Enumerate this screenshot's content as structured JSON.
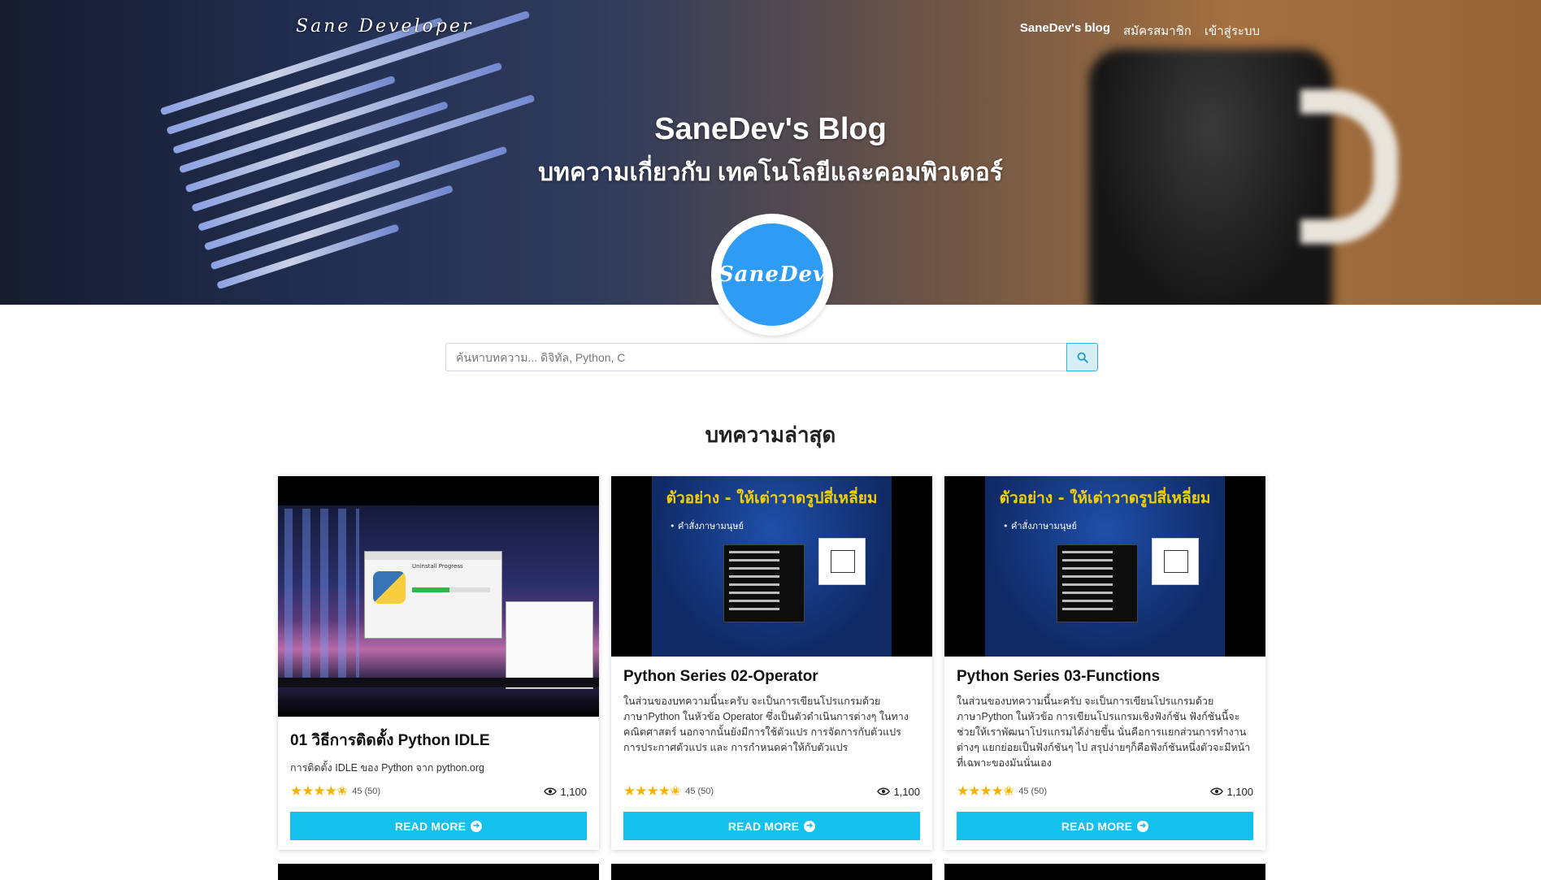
{
  "header": {
    "brand": "Sane Developer",
    "nav": [
      {
        "label": "SaneDev's blog"
      },
      {
        "label": "สมัครสมาชิก"
      },
      {
        "label": "เข้าสู่ระบบ"
      }
    ]
  },
  "hero": {
    "title": "SaneDev's Blog",
    "subtitle": "บทความเกี่ยวกับ เทคโนโลยีและคอมพิวเตอร์",
    "logo_text": "SaneDev"
  },
  "search": {
    "placeholder": "ค้นหาบทความ... ดิจิทัล, Python, C",
    "icon": "search-icon"
  },
  "section": {
    "title": "บทความล่าสุด"
  },
  "cards": [
    {
      "title": "01 วิธีการติดตั้ง Python IDLE",
      "description": "การติดตั้ง IDLE ของ Python จาก python.org",
      "rating_text": "45 (50)",
      "rating_stars": 4.5,
      "views": "1,100",
      "button": "READ MORE",
      "thumb_window_title": "Uninstall Progress"
    },
    {
      "title": "Python Series 02-Operator",
      "description": "ในส่วนของบทความนี้นะครับ จะเป็นการเขียนโปรแกรมด้วยภาษาPython ในหัวข้อ Operator ซึ่งเป็นตัวดำเนินการต่างๆ ในทางคณิตศาสตร์ นอกจากนั้นยังมีการใช้ตัวแปร การจัดการกับตัวแปร การประกาศตัวแปร และ การกำหนดค่าให้กับตัวแปร",
      "rating_text": "45 (50)",
      "rating_stars": 4.5,
      "views": "1,100",
      "button": "READ MORE",
      "slide_title": "ตัวอย่าง - ให้เต่าวาดรูปสี่เหลี่ยม",
      "slide_bullet": "• คำสั่งภาษามนุษย์"
    },
    {
      "title": "Python Series 03-Functions",
      "description": "ในส่วนของบทความนี้นะครับ จะเป็นการเขียนโปรแกรมด้วยภาษาPython ในหัวข้อ การเขียนโปรแกรมเชิงฟังก์ชัน ฟังก์ชันนี้จะช่วยให้เราพัฒนาโปรแกรมได้ง่ายขึ้น นั่นคือการแยกส่วนการทำงานต่างๆ แยกย่อยเป็นฟังก์ชันๆ ไป สรุปง่ายๆก็คือฟังก์ชันหนึ่งตัวจะมีหน้าที่เฉพาะของมันนั่นเอง",
      "rating_text": "45 (50)",
      "rating_stars": 4.5,
      "views": "1,100",
      "button": "READ MORE",
      "slide_title": "ตัวอย่าง - ให้เต่าวาดรูปสี่เหลี่ยม",
      "slide_bullet": "• คำสั่งภาษามนุษย์"
    }
  ],
  "colors": {
    "accent": "#13c1ec",
    "logo_blue": "#2e9cf5",
    "star": "#f5b301"
  }
}
